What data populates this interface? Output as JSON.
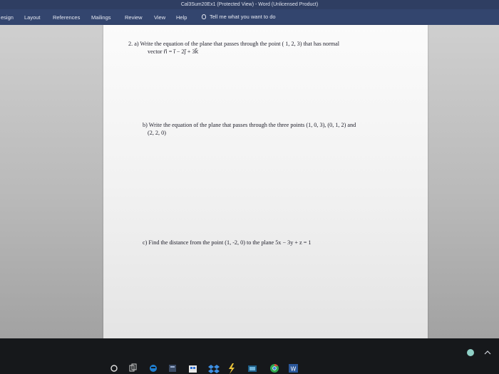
{
  "window": {
    "title": "Cal3Sum20Ex1 (Protected View) - Word (Unlicensed Product)"
  },
  "ribbon": {
    "tabs": [
      "esign",
      "Layout",
      "References",
      "Mailings",
      "Review",
      "View",
      "Help"
    ],
    "tell_me": "Tell me what you want to do"
  },
  "document": {
    "q2a_line1": "2. a)  Write the equation of the plane that passes through the point ( 1, 2, 3) that has normal",
    "q2a_line2": "vector n⃗ = i⃗ − 2j⃗ + 3k⃗",
    "q2b_line1": "b)  Write the equation of the plane that passes through the three points (1, 0, 3), (0, 1, 2) and",
    "q2b_line2": "(2, 2, 0)",
    "q2c_line1": "c)  Find the distance from the point (1, -2, 0) to the plane 5x − 3y + z = 1"
  },
  "taskbar": {
    "icons": [
      "cortana-circle-icon",
      "task-view-icon",
      "edge-browser-icon",
      "calculator-icon",
      "store-icon",
      "dropbox-icon",
      "lightning-icon",
      "photos-icon",
      "chrome-icon",
      "word-icon"
    ]
  },
  "colors": {
    "ribbon": "#33456e",
    "titlebar": "#2f3e62",
    "page": "#f7f7f7",
    "taskbar": "#16181b"
  }
}
